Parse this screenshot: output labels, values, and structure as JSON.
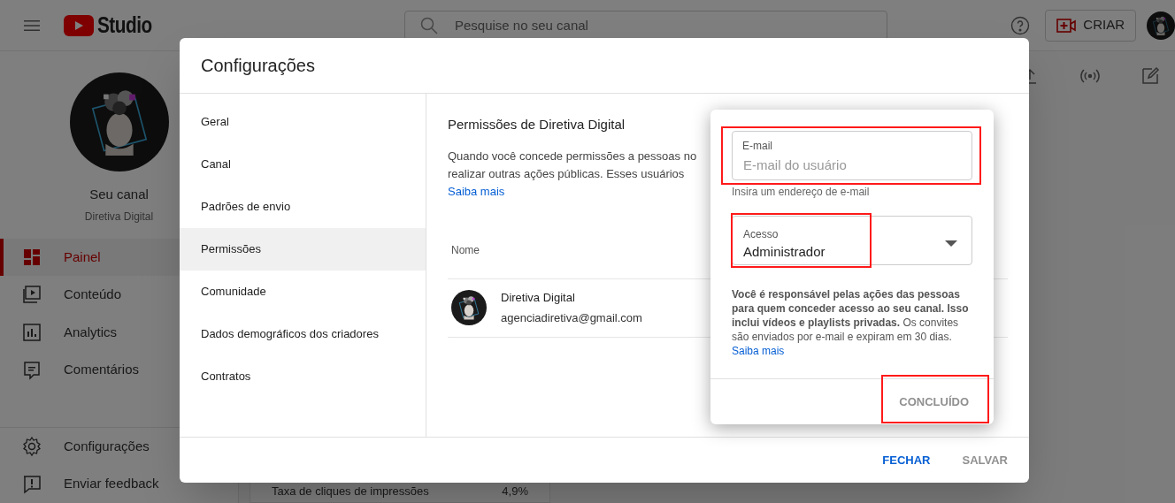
{
  "header": {
    "logo_text": "Studio",
    "search": {
      "placeholder": "Pesquise no seu canal"
    },
    "create_button": "CRIAR"
  },
  "channel": {
    "title": "Seu canal",
    "name": "Diretiva Digital"
  },
  "sidebar": {
    "items": [
      {
        "label": "Painel",
        "selected": true
      },
      {
        "label": "Conteúdo",
        "selected": false
      },
      {
        "label": "Analytics",
        "selected": false
      },
      {
        "label": "Comentários",
        "selected": false
      }
    ],
    "bottom_items": [
      {
        "label": "Configurações"
      },
      {
        "label": "Enviar feedback"
      }
    ]
  },
  "background_metric": {
    "label": "Taxa de cliques de impressões",
    "value": "4,9%"
  },
  "dialog": {
    "title": "Configurações",
    "nav": [
      {
        "label": "Geral",
        "selected": false
      },
      {
        "label": "Canal",
        "selected": false
      },
      {
        "label": "Padrões de envio",
        "selected": false
      },
      {
        "label": "Permissões",
        "selected": true
      },
      {
        "label": "Comunidade",
        "selected": false
      },
      {
        "label": "Dados demográficos dos criadores",
        "selected": false
      },
      {
        "label": "Contratos",
        "selected": false
      }
    ],
    "section_title": "Permissões de Diretiva Digital",
    "description_lines": [
      "Quando você concede permissões a pessoas no",
      "realizar outras ações públicas. Esses usuários"
    ],
    "learn_more": "Saiba mais",
    "column": "Nome",
    "members": [
      {
        "name": "Diretiva Digital",
        "email": "agenciadiretiva@gmail.com"
      }
    ],
    "buttons": [
      {
        "label": "FECHAR",
        "disabled": false
      },
      {
        "label": "SALVAR",
        "disabled": true
      }
    ]
  },
  "popup": {
    "email": {
      "label": "E-mail",
      "placeholder": "E-mail do usuário",
      "helper": "Insira um endereço de e-mail"
    },
    "access": {
      "label": "Acesso",
      "value": "Administrador"
    },
    "notice": "**Você é responsável pelas ações das pessoas para quem conceder acesso ao seu canal. Isso inclui vídeos e playlists privadas.** Os convites são enviados por e-mail e expiram em 30 dias.",
    "link": "Saiba mais",
    "done_button": {
      "label": "CONCLUÍDO",
      "disabled": true
    }
  }
}
